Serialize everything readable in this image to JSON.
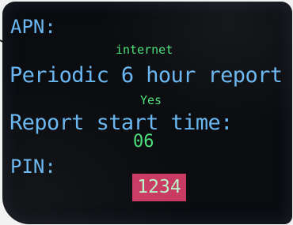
{
  "fields": {
    "apn": {
      "label": "APN:",
      "value": "internet"
    },
    "periodic_report": {
      "label": "Periodic 6 hour report",
      "value": "Yes"
    },
    "report_start_time": {
      "label": "Report start time:",
      "value": "06"
    },
    "pin": {
      "label": "PIN:",
      "value": "1234"
    }
  },
  "colors": {
    "label": "#6ab6f0",
    "value": "#4be07a",
    "highlight_bg": "#c93a62",
    "screen_bg": "#0a0c10"
  }
}
